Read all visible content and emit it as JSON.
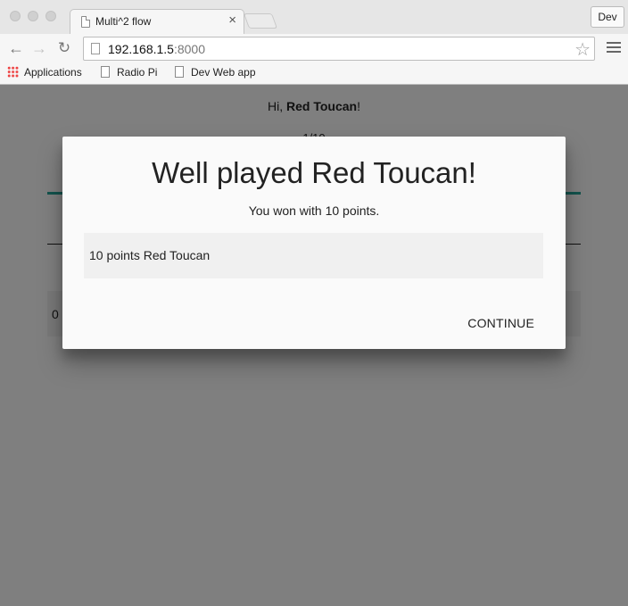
{
  "browser": {
    "tab_title": "Multi^2 flow",
    "tab_close": "×",
    "profile_label": "Dev",
    "url_host": "192.168.1.5",
    "url_port": ":8000",
    "bookmarks": [
      {
        "label": "Applications",
        "icon": "apps-grid-icon"
      },
      {
        "label": "Radio Pi",
        "icon": "page-icon"
      },
      {
        "label": "Dev Web app",
        "icon": "page-icon"
      }
    ]
  },
  "page": {
    "greeting_prefix": "Hi, ",
    "user_name": "Red Toucan",
    "greeting_suffix": "!",
    "progress_text": "1/10",
    "score_value": "0",
    "accent_color": "#26a69a"
  },
  "modal": {
    "title": "Well played Red Toucan!",
    "subtitle": "You won with 10 points.",
    "result_row": "10 points Red Toucan",
    "continue_label": "CONTINUE"
  }
}
